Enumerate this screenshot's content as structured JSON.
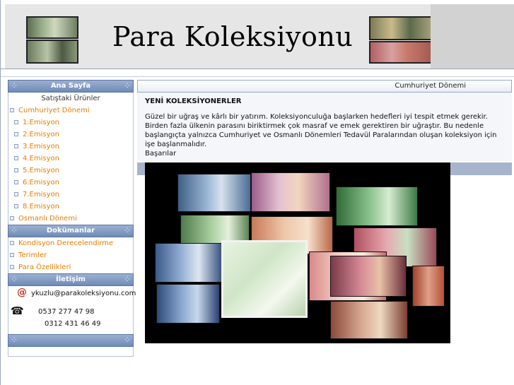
{
  "header": {
    "title": "Para Koleksiyonu",
    "banknote_images": [
      "banknote-icon",
      "banknote-icon",
      "banknote-icon",
      "banknote-icon"
    ]
  },
  "sidebar": {
    "main_section": {
      "title": "Ana Sayfa",
      "items": [
        {
          "label": "Satıştaki Ürünler",
          "level": "center"
        },
        {
          "label": "Cumhuriyet Dönemi",
          "level": 0
        },
        {
          "label": "1.Emisyon",
          "level": 1
        },
        {
          "label": "2.Emisyon",
          "level": 1
        },
        {
          "label": "3.Emisyon",
          "level": 1
        },
        {
          "label": "4.Emisyon",
          "level": 1
        },
        {
          "label": "5.Emisyon",
          "level": 1
        },
        {
          "label": "6.Emisyon",
          "level": 1
        },
        {
          "label": "7.Emisyon",
          "level": 1
        },
        {
          "label": "8.Emisyon",
          "level": 1
        },
        {
          "label": "Osmanlı Dönemi",
          "level": 0
        }
      ]
    },
    "docs_section": {
      "title": "Dokümanlar",
      "items": [
        {
          "label": "Kondisyon Derecelendirme"
        },
        {
          "label": "Terimler"
        },
        {
          "label": "Para Özellikleri"
        }
      ]
    },
    "contact_section": {
      "title": "İletişim",
      "email": "ykuzlu@parakoleksiyonu.com",
      "phone1": "0537 277 47 98",
      "phone2": "0312 431 46 49"
    }
  },
  "main": {
    "header_label": "Cumhuriyet Dönemi",
    "heading": "YENİ KOLEKSİYONERLER",
    "paragraph": "Güzel bir uğraş ve kârlı bir yatırım. Koleksiyonculuğa başlarken hedefleri iyi tespit etmek gerekir. Birden fazla ülkenin parasını biriktirmek çok masraf ve emek gerektiren bir uğraştır. Bu nedenle başlangıçta yalnızca Cumhuriyet ve Osmanlı Dönemleri Tedavül Paralarından oluşan  koleksiyon için işe başlanmalıdır.",
    "closing": "Başarılar",
    "photo_icon": "banknote-collection-photo"
  },
  "colors": {
    "link": "#e67e00",
    "sidebar_header": "#6f8bb8",
    "band": "#a6b5cc"
  }
}
